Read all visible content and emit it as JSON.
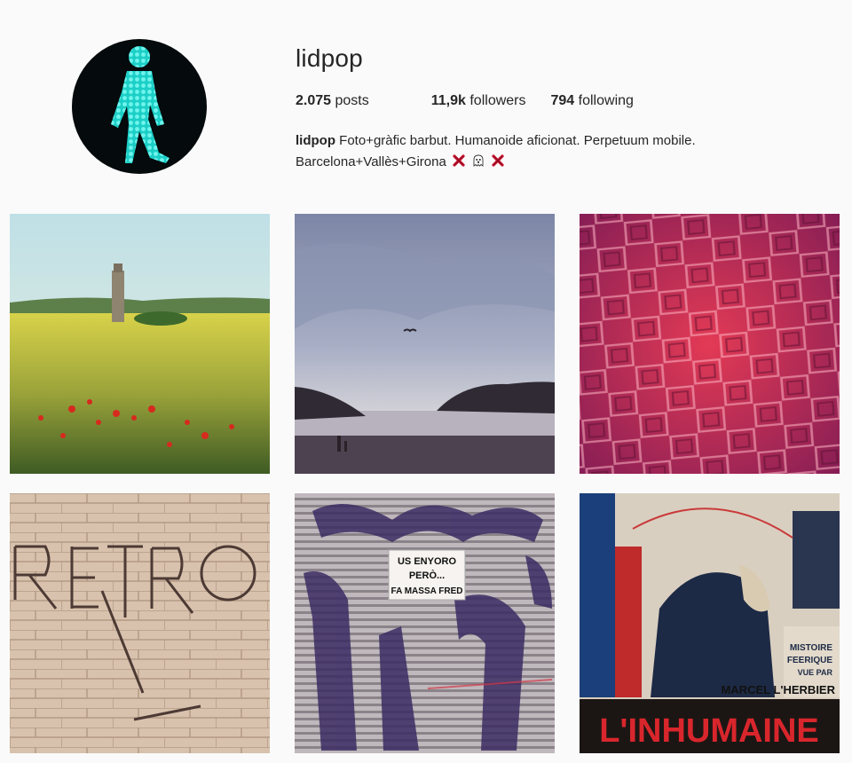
{
  "profile": {
    "username": "lidpop",
    "stats": {
      "posts_count": "2.075",
      "posts_label": "posts",
      "followers_count": "11,9k",
      "followers_label": "followers",
      "following_count": "794",
      "following_label": "following"
    },
    "bio": {
      "name": "lidpop",
      "line1": "Foto+gràfic barbut. Humanoide aficionat. Perpetuum mobile.",
      "line2": "Barcelona+Vallès+Girona",
      "emojis": [
        "cross-mark-icon",
        "ghost-icon",
        "cross-mark-icon"
      ]
    }
  },
  "posts": [
    {
      "subject": "tower-in-rapeseed-field",
      "text": ""
    },
    {
      "subject": "beach-sunset-bird",
      "text": ""
    },
    {
      "subject": "red-tile-pavement",
      "text": ""
    },
    {
      "subject": "retro-sign-wall",
      "text": "RETRO"
    },
    {
      "subject": "graffiti-shutter",
      "lines": [
        "US ENYORO",
        "PERÒ...",
        "FA MASSA FRED"
      ]
    },
    {
      "subject": "inhumaine-poster",
      "lines": [
        "MISTOIRE",
        "FEERIQUE",
        "VUE PAR",
        "MARCEL L'HERBIER",
        "L'INHUMAINE"
      ]
    }
  ],
  "colors": {
    "background": "#fafafa",
    "text": "#262626",
    "avatar_bg": "#050a0c",
    "avatar_figure": "#2fe0d6"
  }
}
